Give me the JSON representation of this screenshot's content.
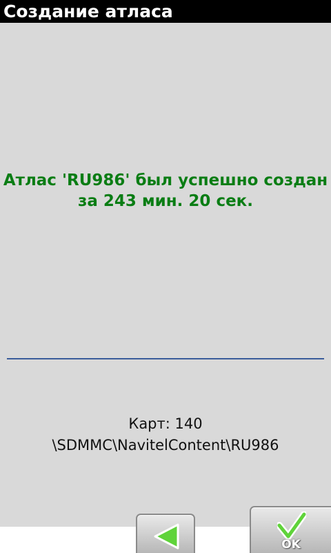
{
  "window": {
    "title": "Создание атласа"
  },
  "message": {
    "line1": "Атлас 'RU986' был успешно создан",
    "line2": "за 243 мин. 20 сек."
  },
  "info": {
    "maps_count": "Карт: 140",
    "path": "\\SDMMC\\NavitelContent\\RU986"
  },
  "toolbar": {
    "back_icon": "back-arrow-icon",
    "ok_icon": "checkmark-icon",
    "ok_label": "OK"
  },
  "colors": {
    "title_bar": "#000000",
    "background": "#d9d9d9",
    "success_text": "#0a7d14",
    "divider": "#3a5c9a",
    "icon_green": "#5fd33a"
  }
}
